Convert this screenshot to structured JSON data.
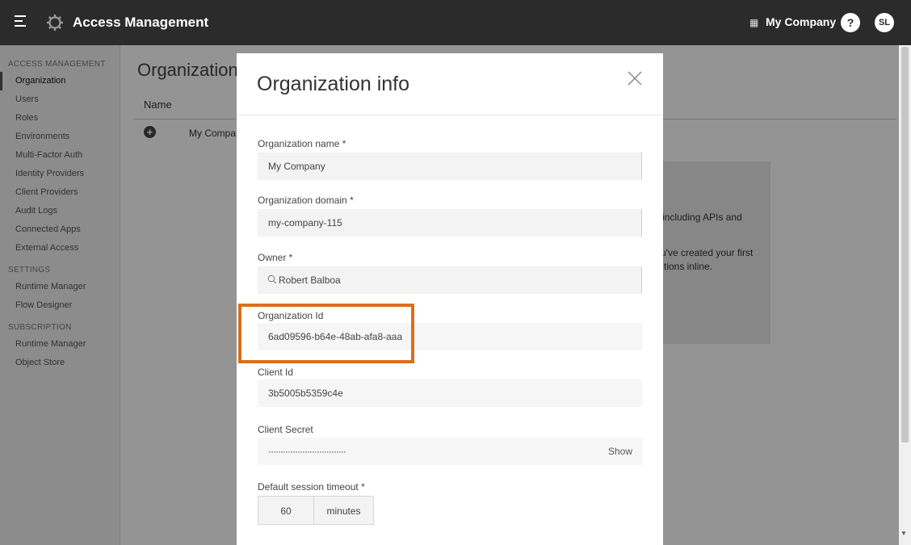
{
  "header": {
    "app_title": "Access Management",
    "org_switcher": "My Company",
    "help": "?",
    "avatar": "SL"
  },
  "sidebar": {
    "sections": [
      {
        "title": "ACCESS MANAGEMENT",
        "items": [
          "Organization",
          "Users",
          "Roles",
          "Environments",
          "Multi-Factor Auth",
          "Identity Providers",
          "Client Providers",
          "Audit Logs",
          "Connected Apps",
          "External Access"
        ]
      },
      {
        "title": "SETTINGS",
        "items": [
          "Runtime Manager",
          "Flow Designer"
        ]
      },
      {
        "title": "SUBSCRIPTION",
        "items": [
          "Runtime Manager",
          "Object Store"
        ]
      }
    ],
    "active_item": "Organization"
  },
  "main": {
    "title": "Organization",
    "column_header": "Name",
    "row_name": "My Compa",
    "info_lines": [
      "including APIs and",
      "u've created your first",
      "tions inline."
    ]
  },
  "modal": {
    "title": "Organization info",
    "fields": {
      "org_name": {
        "label": "Organization name *",
        "value": "My Company"
      },
      "org_domain": {
        "label": "Organization domain *",
        "value": "my-company-115"
      },
      "owner": {
        "label": "Owner *",
        "value": "Robert Balboa"
      },
      "org_id": {
        "label": "Organization Id",
        "value": "6ad09596-b64e-48ab-afa8-aaa"
      },
      "client_id": {
        "label": "Client Id",
        "value": "3b5005b5359c4e"
      },
      "client_secret": {
        "label": "Client Secret",
        "value": "································",
        "show_label": "Show"
      },
      "session_timeout": {
        "label": "Default session timeout *",
        "value": "60",
        "unit": "minutes"
      }
    }
  },
  "colors": {
    "topbar": "#2b2b2b",
    "highlight": "#d96f1c"
  }
}
